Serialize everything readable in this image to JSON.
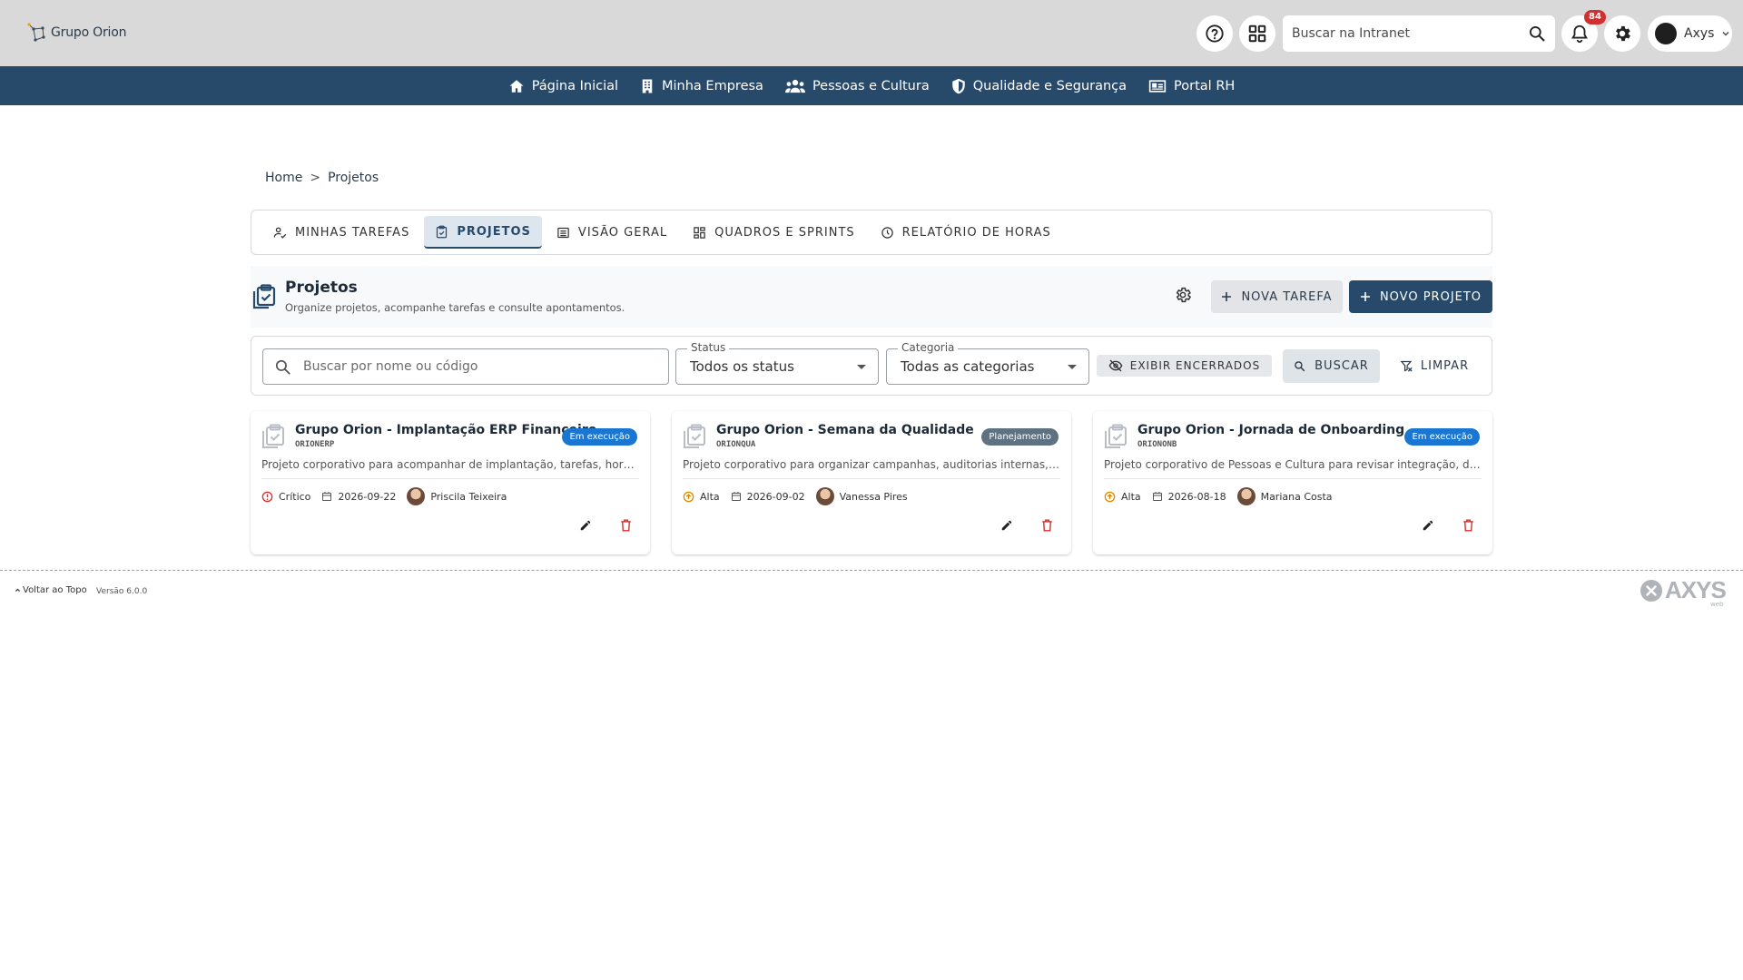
{
  "header": {
    "logo_text": "Grupo Orion",
    "search_placeholder": "Buscar na Intranet",
    "notification_count": "84",
    "user_name": "Axys"
  },
  "nav": {
    "items": [
      {
        "label": "Página Inicial",
        "icon": "home-icon"
      },
      {
        "label": "Minha Empresa",
        "icon": "building-icon"
      },
      {
        "label": "Pessoas e Cultura",
        "icon": "people-icon"
      },
      {
        "label": "Qualidade e Segurança",
        "icon": "shield-icon"
      },
      {
        "label": "Portal RH",
        "icon": "id-card-icon"
      }
    ]
  },
  "breadcrumb": {
    "home": "Home",
    "separator": ">",
    "current": "Projetos"
  },
  "tabs": [
    {
      "label": "MINHAS TAREFAS",
      "active": false
    },
    {
      "label": "PROJETOS",
      "active": true
    },
    {
      "label": "VISÃO GERAL",
      "active": false
    },
    {
      "label": "QUADROS E SPRINTS",
      "active": false
    },
    {
      "label": "RELATÓRIO DE HORAS",
      "active": false
    }
  ],
  "page": {
    "title": "Projetos",
    "subtitle": "Organize projetos, acompanhe tarefas e consulte apontamentos.",
    "new_task_label": "NOVA TAREFA",
    "new_project_label": "NOVO PROJETO"
  },
  "filters": {
    "search_placeholder": "Buscar por nome ou código",
    "status_label": "Status",
    "status_value": "Todos os status",
    "category_label": "Categoria",
    "category_value": "Todas as categorias",
    "show_closed_label": "EXIBIR ENCERRADOS",
    "search_label": "BUSCAR",
    "clear_label": "LIMPAR"
  },
  "projects": [
    {
      "title": "Grupo Orion - Implantação ERP Financeiro",
      "code": "ORIONERP",
      "status": "Em execução",
      "status_color": "#1976d2",
      "description": "Projeto corporativo para acompanhar de implantação, tarefas, horas e pendências do ERP Financeiro.",
      "priority": "Crítico",
      "priority_color": "#d32f2f",
      "date": "2026-09-22",
      "owner": "Priscila Teixeira"
    },
    {
      "title": "Grupo Orion - Semana da Qualidade",
      "code": "ORIONQUA",
      "status": "Planejamento",
      "status_color": "#5f7282",
      "description": "Projeto corporativo para organizar campanhas, auditorias internas, indicadores e ações da qualidade.",
      "priority": "Alta",
      "priority_color": "#e08a00",
      "date": "2026-09-02",
      "owner": "Vanessa Pires"
    },
    {
      "title": "Grupo Orion - Jornada de Onboarding",
      "code": "ORIONONB",
      "status": "Em execução",
      "status_color": "#1976d2",
      "description": "Projeto corporativo de Pessoas e Cultura para revisar integração, documentos e trilhas de onboarding.",
      "priority": "Alta",
      "priority_color": "#e08a00",
      "date": "2026-08-18",
      "owner": "Mariana Costa"
    }
  ],
  "footer": {
    "back_to_top": "Voltar ao Topo",
    "version": "Versão 6.0.0",
    "brand": "AXYS",
    "brand_sub": "web"
  },
  "colors": {
    "primary": "#274a6b",
    "danger": "#d32f2f",
    "topbar": "#d9d9d9"
  }
}
